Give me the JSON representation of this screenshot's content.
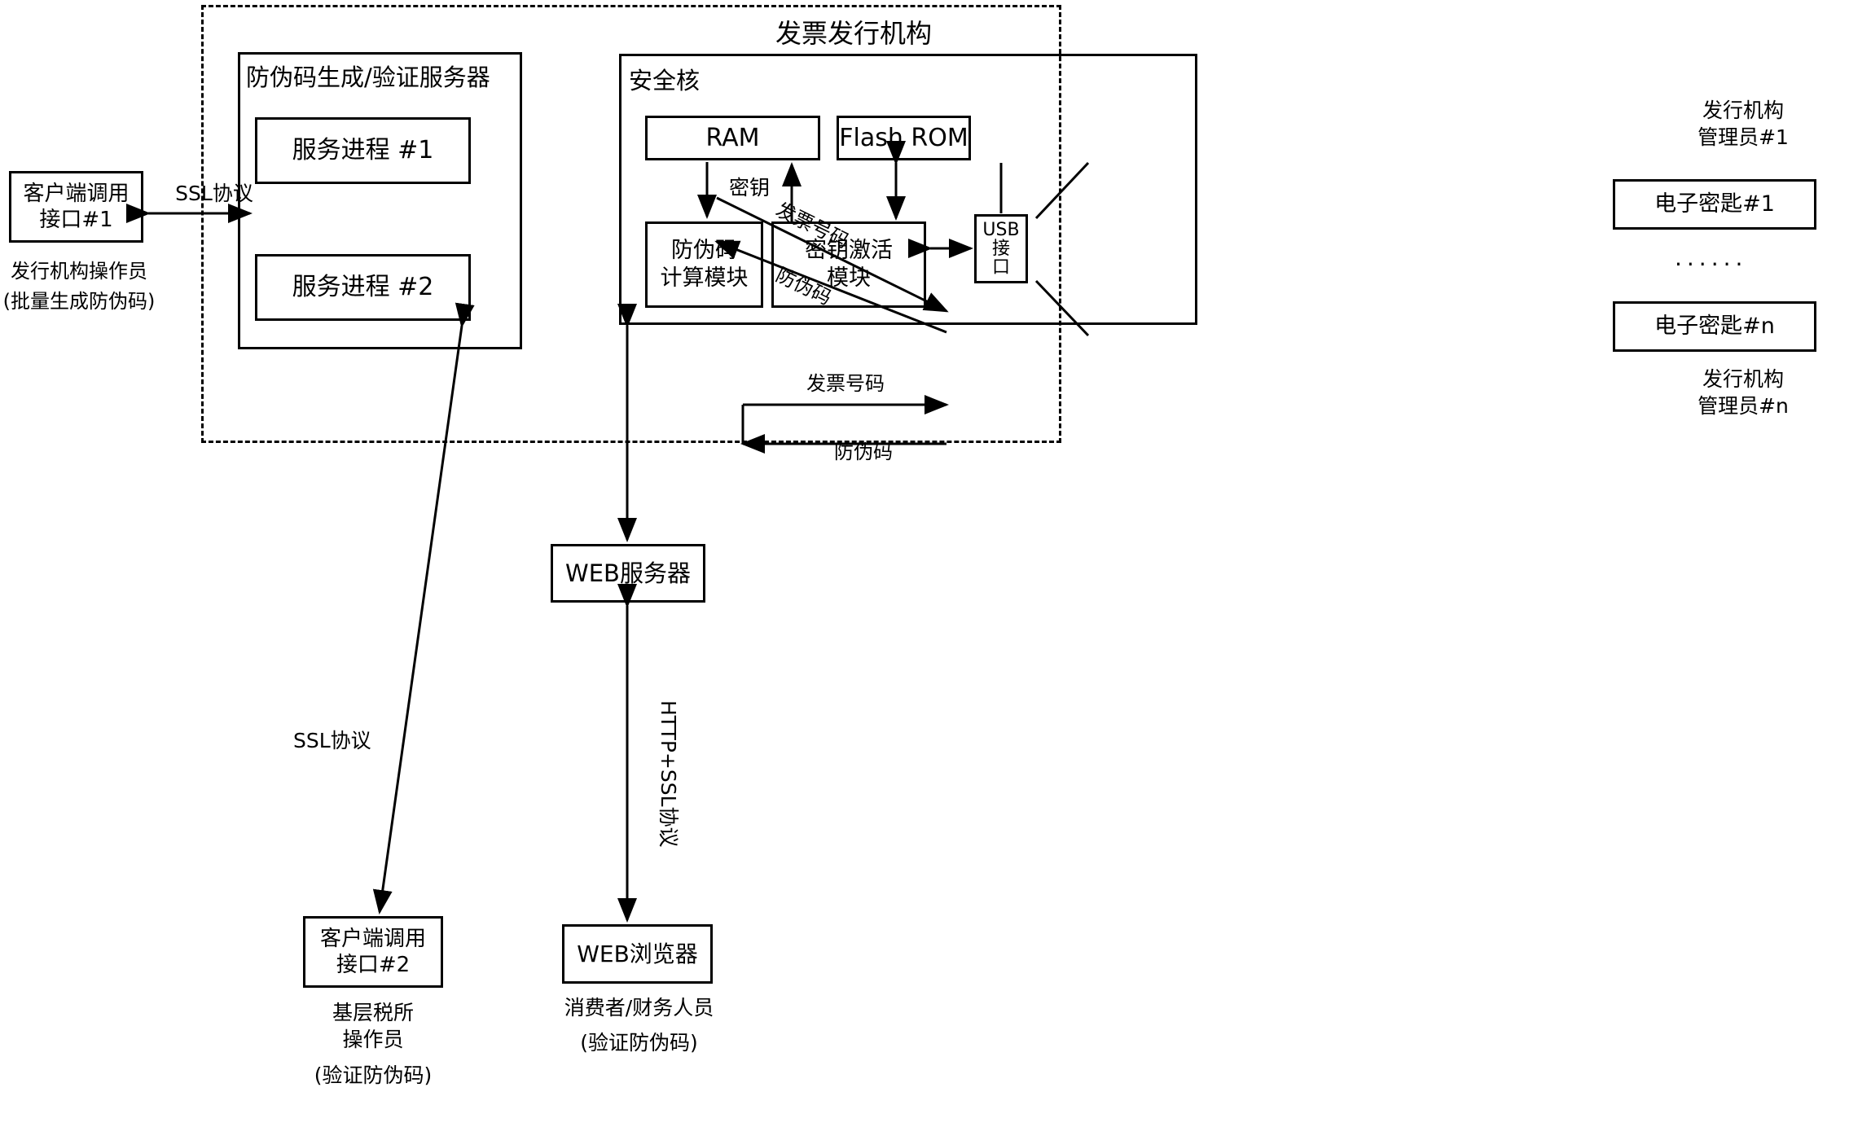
{
  "diagram": {
    "outer_title": "发票发行机构",
    "server_group_title": "防伪码生成/验证服务器",
    "secure_core_title": "安全核",
    "boxes": {
      "client_if1": "客户端调用\n接口#1",
      "client_if2": "客户端调用\n接口#2",
      "service_proc1": "服务进程 #1",
      "service_proc2": "服务进程 #2",
      "web_server": "WEB服务器",
      "web_browser": "WEB浏览器",
      "ram": "RAM",
      "flash_rom": "Flash ROM",
      "code_calc_module": "防伪码\n计算模块",
      "key_activate_module": "密钥激活\n模块",
      "usb_interface": "USB\n接\n口",
      "ekey_1": "电子密匙#1",
      "ekey_n": "电子密匙#n"
    },
    "captions": {
      "operator_left": "发行机构操作员",
      "operator_left_sub": "(批量生成防伪码)",
      "admin_top": "发行机构\n管理员#1",
      "admin_bottom": "发行机构\n管理员#n",
      "tax_operator": "基层税所\n操作员",
      "tax_operator_sub": "(验证防伪码)",
      "consumer": "消费者/财务人员",
      "consumer_sub": "(验证防伪码)",
      "ellipsis": "......"
    },
    "edge_labels": {
      "ssl_top": "SSL协议",
      "ssl_bottom": "SSL协议",
      "http_ssl": "HTTP+SSL协议",
      "invoice_no_diag": "发票号码",
      "code_diag": "防伪码",
      "invoice_no_h": "发票号码",
      "code_h": "防伪码",
      "key": "密钥"
    }
  }
}
